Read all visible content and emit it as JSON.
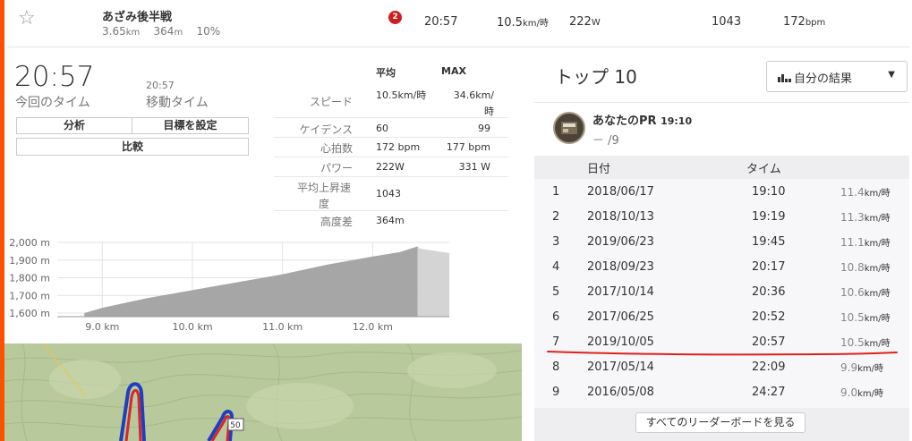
{
  "segment": {
    "name": "あざみ後半戦",
    "distance": "3.65",
    "distance_unit": "km",
    "elevation": "364",
    "elevation_unit": "m",
    "grade": "10%",
    "rank_badge": "2",
    "time": "20:57",
    "speed": "10.5",
    "speed_unit": "km/時",
    "power": "222",
    "power_unit": "W",
    "value_1043": "1043",
    "heartrate": "172",
    "heartrate_unit": "bpm"
  },
  "summary": {
    "elapsed_time": "20:57",
    "elapsed_label": "今回のタイム",
    "moving_time": "20:57",
    "moving_label": "移動タイム",
    "analysis_button": "分析",
    "goal_button": "目標を設定",
    "compare_button": "比較"
  },
  "stats": {
    "avg_header": "平均",
    "max_header": "MAX",
    "rows": [
      {
        "label": "スピード",
        "avg": "10.5km/時",
        "max": "34.6km/時"
      },
      {
        "label": "ケイデンス",
        "avg": "60",
        "max": "99"
      },
      {
        "label": "心拍数",
        "avg": "172 bpm",
        "max": "177 bpm"
      },
      {
        "label": "パワー",
        "avg": "222W",
        "max": "331 W"
      },
      {
        "label": "平均上昇速度",
        "avg": "1043",
        "max": ""
      },
      {
        "label": "高度差",
        "avg": "364m",
        "max": ""
      }
    ]
  },
  "chart_data": {
    "type": "area",
    "y_ticks": [
      "2,000 m",
      "1,900 m",
      "1,800 m",
      "1,700 m",
      "1,600 m"
    ],
    "x_ticks": [
      "9.0 km",
      "10.0 km",
      "11.0 km",
      "12.0 km"
    ],
    "ylim": [
      1580,
      2000
    ],
    "xlim": [
      8.5,
      12.85
    ],
    "x": [
      8.8,
      9.0,
      9.5,
      10.0,
      10.5,
      11.0,
      11.5,
      12.0,
      12.3,
      12.5,
      12.52,
      12.85
    ],
    "y": [
      1600,
      1630,
      1685,
      1730,
      1775,
      1820,
      1875,
      1920,
      1945,
      1978,
      1965,
      1940
    ],
    "colors": {
      "fill": "#a6a6a6",
      "fill_after": "#d4d4d4"
    }
  },
  "leaderboard": {
    "title": "トップ 10",
    "filter_label": "自分の結果",
    "pr_label": "あなたのPR",
    "pr_time": "19:10",
    "pr_rank": "－ /9",
    "col_date": "日付",
    "col_time": "タイム",
    "rows": [
      {
        "rank": "1",
        "date": "2018/06/17",
        "time": "19:10",
        "speed": "11.4",
        "unit": "km/時"
      },
      {
        "rank": "2",
        "date": "2018/10/13",
        "time": "19:19",
        "speed": "11.3",
        "unit": "km/時"
      },
      {
        "rank": "3",
        "date": "2019/06/23",
        "time": "19:45",
        "speed": "11.1",
        "unit": "km/時"
      },
      {
        "rank": "4",
        "date": "2018/09/23",
        "time": "20:17",
        "speed": "10.8",
        "unit": "km/時"
      },
      {
        "rank": "5",
        "date": "2017/10/14",
        "time": "20:36",
        "speed": "10.6",
        "unit": "km/時"
      },
      {
        "rank": "6",
        "date": "2017/06/25",
        "time": "20:52",
        "speed": "10.5",
        "unit": "km/時"
      },
      {
        "rank": "7",
        "date": "2019/10/05",
        "time": "20:57",
        "speed": "10.5",
        "unit": "km/時"
      },
      {
        "rank": "8",
        "date": "2017/05/14",
        "time": "22:09",
        "speed": "9.9",
        "unit": "km/時"
      },
      {
        "rank": "9",
        "date": "2016/05/08",
        "time": "24:27",
        "speed": "9.0",
        "unit": "km/時"
      }
    ],
    "see_all_button": "すべてのリーダーボードを見る"
  },
  "map": {
    "road_label": "50"
  },
  "icons": {
    "star": "star-icon",
    "bars": "bar-chart-icon",
    "chevron": "chevron-down-icon"
  },
  "colors": {
    "accent": "#fc5200",
    "badge": "#cc1f1f",
    "underline": "#e0201a"
  }
}
